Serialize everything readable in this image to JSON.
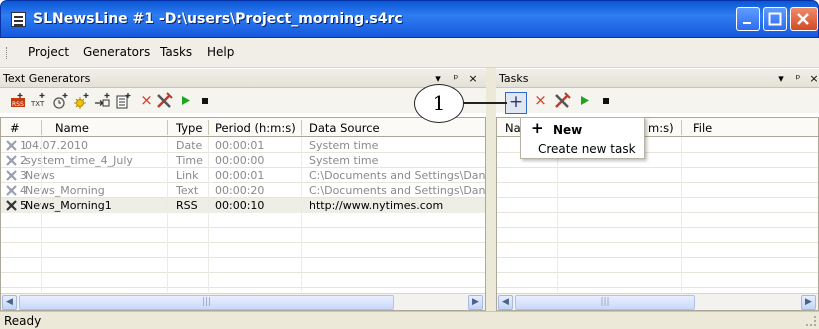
{
  "window": {
    "title": "SLNewsLine #1 -D:\\users\\Project_morning.s4rc",
    "minimize_label": "Minimize",
    "maximize_label": "Maximize",
    "close_label": "Close"
  },
  "menu": {
    "items": [
      "Project",
      "Generators",
      "Tasks",
      "Help"
    ]
  },
  "left_panel": {
    "title": "Text Generators",
    "header_buttons": [
      "▾",
      "ᵖ",
      "×"
    ],
    "toolbar_icons": [
      "add-rss-icon",
      "add-txt-icon",
      "add-time-icon",
      "add-sun-icon",
      "add-link-icon",
      "add-text-icon",
      "delete-icon",
      "properties-icon",
      "play-icon",
      "stop-icon"
    ],
    "toolbar_glyphs": {
      "add_txt": "TXT",
      "delete": "×"
    },
    "columns": [
      "#",
      "Name",
      "Type",
      "Period (h:m:s)",
      "Data Source"
    ],
    "rows": [
      {
        "num": "1",
        "name": "04.07.2010",
        "type": "Date",
        "period": "00:00:01",
        "source": "System time",
        "active": false
      },
      {
        "num": "2",
        "name": "system_time_4_July",
        "type": "Time",
        "period": "00:00:00",
        "source": "System time",
        "active": false
      },
      {
        "num": "3",
        "name": "News",
        "type": "Link",
        "period": "00:00:01",
        "source": "C:\\Documents and Settings\\Danile",
        "active": false
      },
      {
        "num": "4",
        "name": "News_Morning",
        "type": "Text",
        "period": "00:00:20",
        "source": "C:\\Documents and Settings\\Danile",
        "active": false
      },
      {
        "num": "5",
        "name": "News_Morning1",
        "type": "RSS",
        "period": "00:00:10",
        "source": "http://www.nytimes.com",
        "active": true
      }
    ],
    "scroll_thumb_label": "|||"
  },
  "right_panel": {
    "title": "Tasks",
    "header_buttons": [
      "▾",
      "ᵖ",
      "×"
    ],
    "toolbar": {
      "new_glyph": "+",
      "delete_glyph": "×"
    },
    "columns": [
      "Nar",
      "m:s)",
      "File"
    ],
    "scroll_thumb_label": "|||"
  },
  "popup_menu": {
    "items": [
      {
        "icon": "+",
        "label": "New",
        "bold": true
      },
      {
        "icon": "",
        "label": "Create new task",
        "bold": false
      }
    ]
  },
  "callout": {
    "label": "1"
  },
  "status": {
    "text": "Ready"
  },
  "colors": {
    "title_blue": "#2f7cf0",
    "status_bg": "#ece9d8",
    "play_green": "#1ea51e",
    "delete_red": "#d23a2a"
  }
}
